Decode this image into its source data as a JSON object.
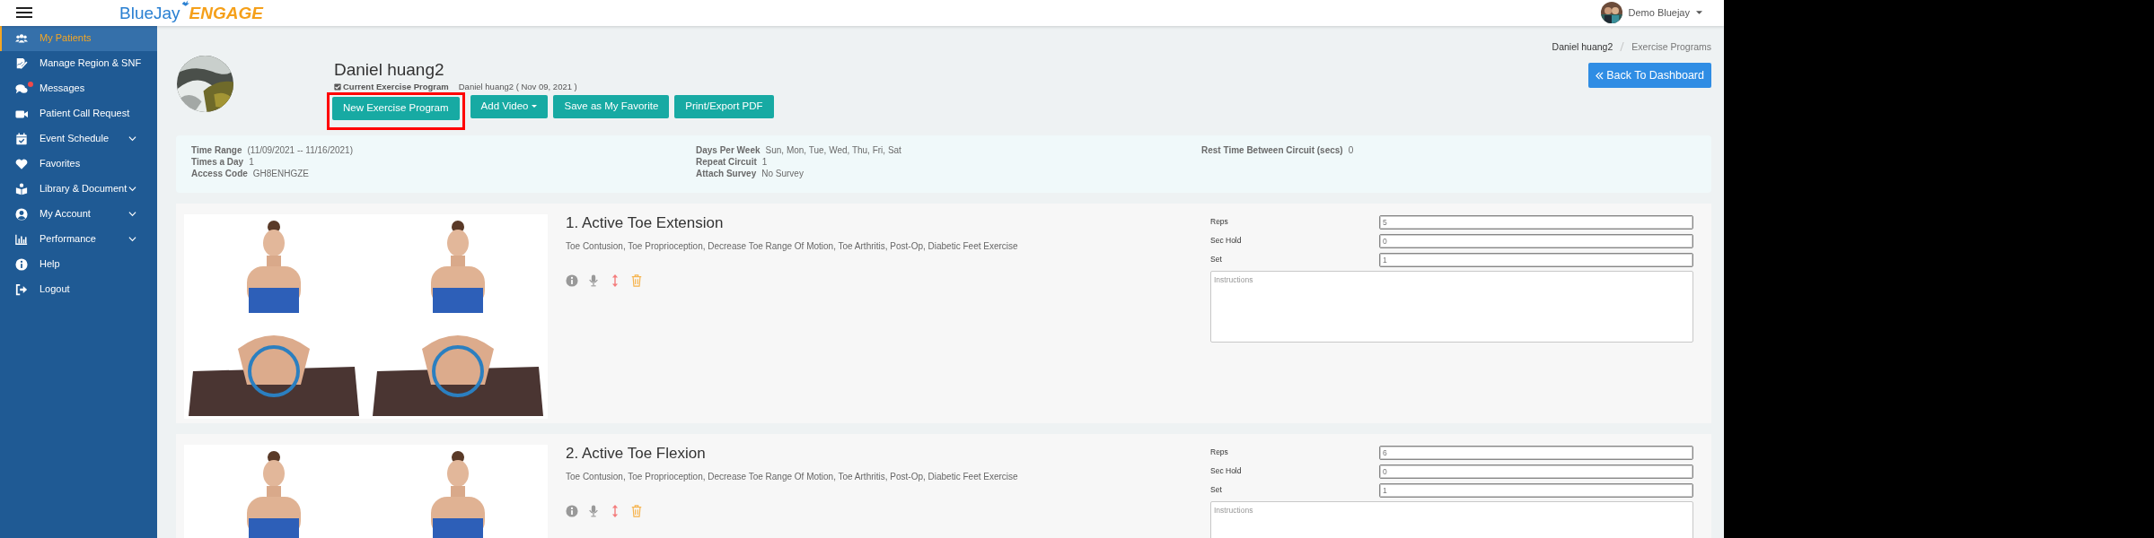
{
  "logo": {
    "brand": "BlueJay",
    "product": "ENGAGE"
  },
  "user": {
    "name": "Demo Bluejay"
  },
  "sidebar": {
    "items": [
      {
        "label": "My Patients",
        "selected": true,
        "expandable": false,
        "unread": false
      },
      {
        "label": "Manage Region & SNF",
        "selected": false,
        "expandable": false,
        "unread": false
      },
      {
        "label": "Messages",
        "selected": false,
        "expandable": false,
        "unread": true
      },
      {
        "label": "Patient Call Request",
        "selected": false,
        "expandable": false,
        "unread": false
      },
      {
        "label": "Event Schedule",
        "selected": false,
        "expandable": true,
        "unread": false
      },
      {
        "label": "Favorites",
        "selected": false,
        "expandable": false,
        "unread": false
      },
      {
        "label": "Library & Document",
        "selected": false,
        "expandable": true,
        "unread": false
      },
      {
        "label": "My Account",
        "selected": false,
        "expandable": true,
        "unread": false
      },
      {
        "label": "Performance",
        "selected": false,
        "expandable": true,
        "unread": false
      },
      {
        "label": "Help",
        "selected": false,
        "expandable": false,
        "unread": false
      },
      {
        "label": "Logout",
        "selected": false,
        "expandable": false,
        "unread": false
      }
    ]
  },
  "breadcrumb": [
    "Daniel huang2",
    "Exercise Programs"
  ],
  "back_button": {
    "label": "Back To Dashboard"
  },
  "patient": {
    "name": "Daniel huang2",
    "program_label": "Current Exercise Program",
    "program_checked": true,
    "program_value": "Daniel huang2 ( Nov 09, 2021 )"
  },
  "actions": [
    {
      "label": "New Exercise Program",
      "highlighted": true,
      "dropdown": false
    },
    {
      "label": "Add Video",
      "highlighted": false,
      "dropdown": true
    },
    {
      "label": "Save as My Favorite",
      "highlighted": false,
      "dropdown": false
    },
    {
      "label": "Print/Export PDF",
      "highlighted": false,
      "dropdown": false
    }
  ],
  "program_info": {
    "columns": [
      [
        {
          "label": "Time Range",
          "value": "(11/09/2021 -- 11/16/2021)"
        },
        {
          "label": "Times a Day",
          "value": "1"
        },
        {
          "label": "Access Code",
          "value": "GH8ENHGZE"
        }
      ],
      [
        {
          "label": "Days Per Week",
          "value": "Sun, Mon, Tue, Wed, Thu, Fri, Sat"
        },
        {
          "label": "Repeat Circuit",
          "value": "1"
        },
        {
          "label": "Attach Survey",
          "value": "No Survey"
        }
      ],
      [
        {
          "label": "Rest Time Between Circuit (secs)",
          "value": "0"
        }
      ]
    ]
  },
  "exercises": [
    {
      "title": "1. Active Toe Extension",
      "description": "Toe Contusion, Toe Proprioception, Decrease Toe Range Of Motion, Toe Arthritis, Post-Op, Diabetic Feet Exercise",
      "fields": [
        {
          "label": "Reps",
          "value": "5"
        },
        {
          "label": "Sec Hold",
          "value": "0"
        },
        {
          "label": "Set",
          "value": "1"
        }
      ],
      "instructions": {
        "placeholder": "Instructions"
      }
    },
    {
      "title": "2. Active Toe Flexion",
      "description": "Toe Contusion, Toe Proprioception, Decrease Toe Range Of Motion, Toe Arthritis, Post-Op, Diabetic Feet Exercise",
      "fields": [
        {
          "label": "Reps",
          "value": "6"
        },
        {
          "label": "Sec Hold",
          "value": "0"
        },
        {
          "label": "Set",
          "value": "1"
        }
      ],
      "instructions": {
        "placeholder": "Instructions"
      }
    }
  ]
}
